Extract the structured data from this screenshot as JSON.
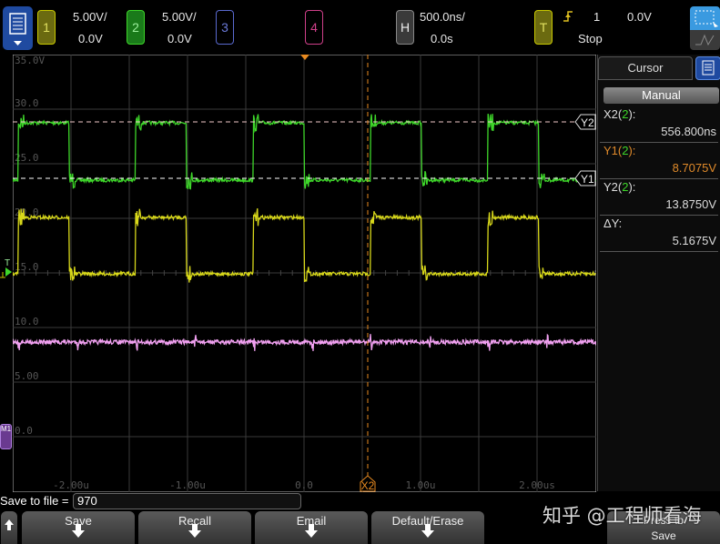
{
  "topbar": {
    "ch1": {
      "label": "1",
      "scale": "5.00V/",
      "offset": "0.0V",
      "color": "#c8c800"
    },
    "ch2": {
      "label": "2",
      "scale": "5.00V/",
      "offset": "0.0V",
      "color": "#2fb82f"
    },
    "ch3": {
      "label": "3",
      "color": "#5a6ad0"
    },
    "ch4": {
      "label": "4",
      "color": "#d0408a"
    },
    "horizontal": {
      "label": "H",
      "scale": "500.0ns/",
      "delay": "0.0s"
    },
    "trigger": {
      "label": "T",
      "source": "1",
      "level": "0.0V",
      "status": "Stop",
      "edge_icon": "rising-edge-icon"
    }
  },
  "grid": {
    "y_labels": [
      "35.0V",
      "30.0",
      "25.0",
      "20.0",
      "15.0",
      "10.0",
      "5.00",
      "0.0"
    ],
    "x_labels": [
      "-2.00u",
      "-1.00u",
      "0.0",
      "1.00u",
      "2.00us"
    ]
  },
  "markers": {
    "y1": "Y1",
    "y2": "Y2",
    "x2": "X2",
    "trigger": "T",
    "math": "M1"
  },
  "cursor_panel": {
    "title": "Cursor",
    "mode": "Manual",
    "rows": [
      {
        "label": "X2(",
        "src": "2",
        "end": "):",
        "value": "556.800ns",
        "color": "#dddddd"
      },
      {
        "label": "Y1(",
        "src": "2",
        "end": "):",
        "value": "8.7075V",
        "color": "#e08a2a"
      },
      {
        "label": "Y2(",
        "src": "2",
        "end": "):",
        "value": "13.8750V",
        "color": "#dddddd"
      },
      {
        "label": "ΔY:",
        "src": "",
        "end": "",
        "value": "5.1675V",
        "color": "#dddddd"
      }
    ]
  },
  "save": {
    "label": "Save to file =",
    "filename": "970"
  },
  "softkeys": [
    "Save",
    "Recall",
    "Email",
    "Default/Erase"
  ],
  "press_to_save": {
    "line1": "Press to",
    "line2": "Save"
  },
  "watermark": "知乎 @工程师看海",
  "colors": {
    "ch1": "#d8d81a",
    "ch2": "#3ed62a",
    "math": "#f0a0f0",
    "cursor_x": "#e88a20"
  }
}
